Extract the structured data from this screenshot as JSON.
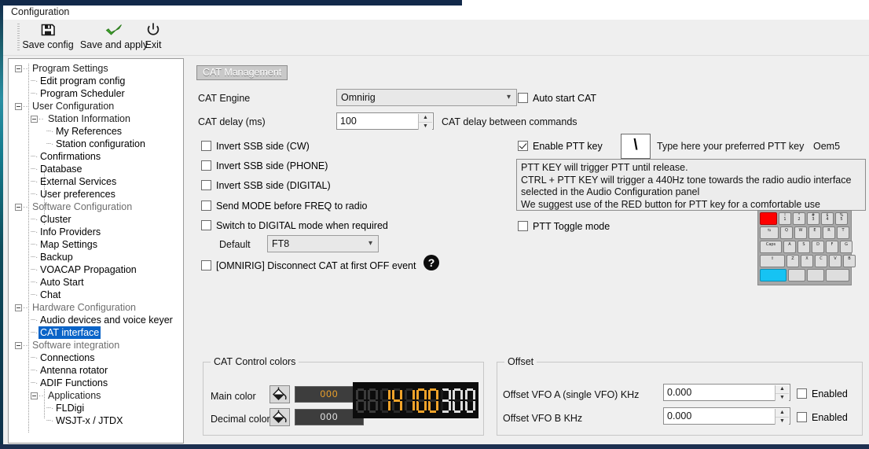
{
  "window": {
    "title": "Configuration"
  },
  "toolbar": {
    "items": [
      {
        "label": "Save config",
        "icon": "floppy-disk-icon"
      },
      {
        "label": "Save and apply",
        "icon": "green-check-icon"
      },
      {
        "label": "Exit",
        "icon": "power-icon"
      }
    ]
  },
  "tree": {
    "nodes": [
      {
        "label": "Program Settings",
        "depth": 0,
        "type": "group"
      },
      {
        "label": "Edit program config",
        "depth": 1,
        "type": "leaf"
      },
      {
        "label": "Program Scheduler",
        "depth": 1,
        "type": "leaf"
      },
      {
        "label": "User Configuration",
        "depth": 0,
        "type": "group"
      },
      {
        "label": "Station Information",
        "depth": 1,
        "type": "group"
      },
      {
        "label": "My References",
        "depth": 2,
        "type": "leaf"
      },
      {
        "label": "Station configuration",
        "depth": 2,
        "type": "leaf"
      },
      {
        "label": "Confirmations",
        "depth": 1,
        "type": "leaf"
      },
      {
        "label": "Database",
        "depth": 1,
        "type": "leaf"
      },
      {
        "label": "External Services",
        "depth": 1,
        "type": "leaf"
      },
      {
        "label": "User preferences",
        "depth": 1,
        "type": "leaf"
      },
      {
        "label": "Software Configuration",
        "depth": 0,
        "type": "group-dim"
      },
      {
        "label": "Cluster",
        "depth": 1,
        "type": "leaf"
      },
      {
        "label": "Info Providers",
        "depth": 1,
        "type": "leaf"
      },
      {
        "label": "Map Settings",
        "depth": 1,
        "type": "leaf"
      },
      {
        "label": "Backup",
        "depth": 1,
        "type": "leaf"
      },
      {
        "label": "VOACAP Propagation",
        "depth": 1,
        "type": "leaf"
      },
      {
        "label": "Auto Start",
        "depth": 1,
        "type": "leaf"
      },
      {
        "label": "Chat",
        "depth": 1,
        "type": "leaf"
      },
      {
        "label": "Hardware Configuration",
        "depth": 0,
        "type": "group-dim"
      },
      {
        "label": "Audio devices and voice keyer",
        "depth": 1,
        "type": "leaf"
      },
      {
        "label": "CAT interface",
        "depth": 1,
        "type": "leaf-selected"
      },
      {
        "label": "Software integration",
        "depth": 0,
        "type": "group-dim"
      },
      {
        "label": "Connections",
        "depth": 1,
        "type": "leaf"
      },
      {
        "label": "Antenna rotator",
        "depth": 1,
        "type": "leaf"
      },
      {
        "label": "ADIF Functions",
        "depth": 1,
        "type": "leaf"
      },
      {
        "label": "Applications",
        "depth": 1,
        "type": "group"
      },
      {
        "label": "FLDigi",
        "depth": 2,
        "type": "leaf"
      },
      {
        "label": "WSJT-x / JTDX",
        "depth": 2,
        "type": "leaf"
      }
    ]
  },
  "cat": {
    "section_title": "CAT Management",
    "engine_label": "CAT Engine",
    "engine_value": "Omnirig",
    "delay_label": "CAT delay (ms)",
    "delay_value": "100",
    "delay_hint": "CAT delay between commands",
    "auto_start_label": "Auto start CAT",
    "auto_start_checked": false,
    "checkboxes": [
      {
        "label": "Invert SSB side (CW)",
        "checked": false
      },
      {
        "label": "Invert SSB side (PHONE)",
        "checked": false
      },
      {
        "label": "Invert SSB side (DIGITAL)",
        "checked": false
      },
      {
        "label": "Send MODE before FREQ to radio",
        "checked": false
      },
      {
        "label": "Switch to DIGITAL mode when required",
        "checked": false
      }
    ],
    "default_label": "Default",
    "default_value": "FT8",
    "disconnect_label": "[OMNIRIG] Disconnect CAT at first OFF event",
    "disconnect_checked": false,
    "help_glyph": "?"
  },
  "ptt": {
    "enable_label": "Enable PTT key",
    "enable_checked": true,
    "key_glyph": "\\",
    "type_hint": "Type here your preferred PTT key",
    "key_name": "Oem5",
    "info_text": "PTT KEY will trigger PTT until release.\nCTRL + PTT KEY will trigger a 440Hz tone towards the radio audio interface\nselected in the Audio Configuration panel\nWe suggest use of the RED button for PTT key for a comfortable use",
    "toggle_label": "PTT Toggle mode",
    "toggle_checked": false,
    "keyboard": {
      "highlight_color": "#fe0000",
      "space_color": "#16c3f3",
      "rows": [
        [
          "",
          "!\n1",
          "\"\n2",
          "#\n3",
          "$\n4",
          "%\n5"
        ],
        [
          "⇆",
          "Q",
          "W",
          "E",
          "R",
          "T"
        ],
        [
          "Caps",
          "A",
          "S",
          "D",
          "F",
          "G"
        ],
        [
          "⇧",
          "Z",
          "X",
          "C",
          "V",
          "B"
        ],
        [
          "",
          "",
          "",
          "",
          "",
          ""
        ]
      ]
    }
  },
  "colors": {
    "group_title": "CAT Control colors",
    "main_label": "Main color",
    "main_value": "000",
    "main_hex": "#f0a32a",
    "decimal_label": "Decimal color",
    "decimal_value": "000",
    "decimal_hex": "#e8e8e8",
    "bucket_icon": "paint-bucket-icon",
    "lcd": {
      "digits": [
        "8",
        "8",
        "1",
        "4",
        "1",
        "0",
        "0",
        "3",
        "0",
        "0"
      ],
      "lit": [
        false,
        false,
        true,
        true,
        true,
        true,
        true,
        false,
        false,
        false
      ],
      "dots": [
        false,
        false,
        false,
        false,
        false,
        false,
        false,
        false,
        false,
        false
      ],
      "display_text": "14.100.300"
    }
  },
  "offset": {
    "group_title": "Offset",
    "rows": [
      {
        "label": "Offset VFO A (single VFO) KHz",
        "value": "0.000",
        "enabled_label": "Enabled",
        "checked": false
      },
      {
        "label": "Offset VFO B KHz",
        "value": "0.000",
        "enabled_label": "Enabled",
        "checked": false
      }
    ]
  }
}
